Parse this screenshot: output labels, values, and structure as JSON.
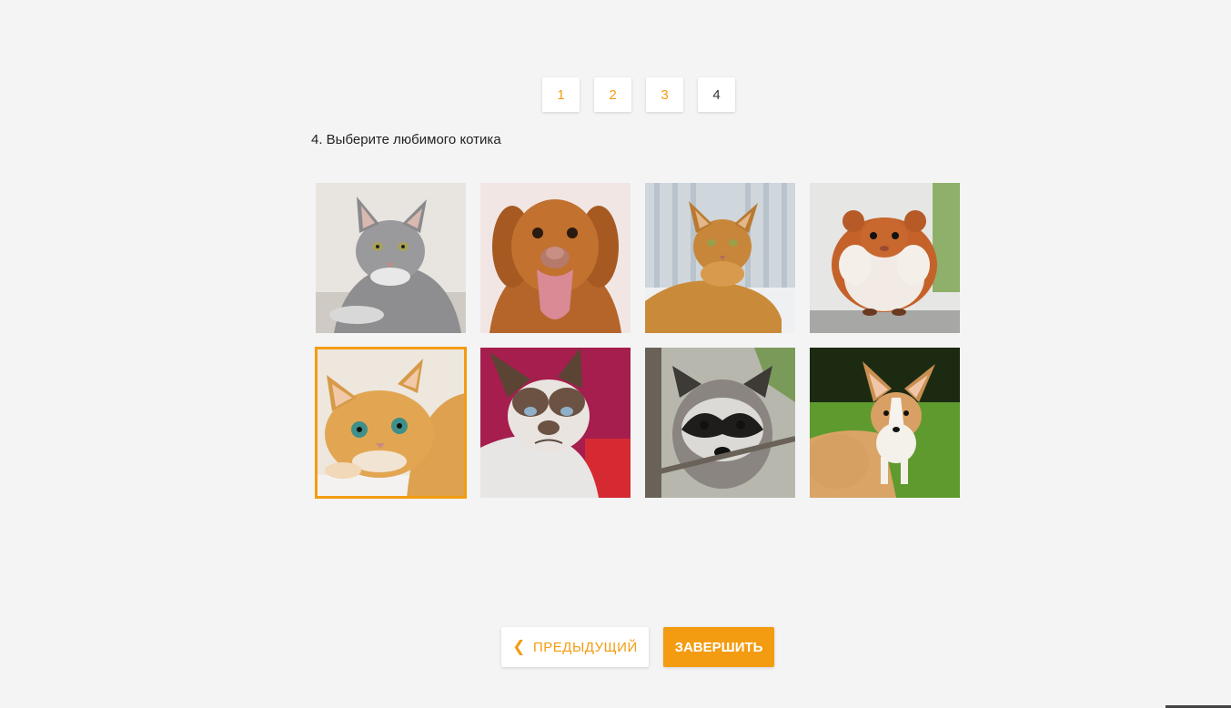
{
  "pager": {
    "pages": [
      "1",
      "2",
      "3",
      "4"
    ],
    "current": "4"
  },
  "question": {
    "text": "4. Выберите любимого котика"
  },
  "images": [
    {
      "name": "grey-tabby-cat",
      "selected": false
    },
    {
      "name": "golden-dog",
      "selected": false
    },
    {
      "name": "ginger-abyssinian-cat",
      "selected": false
    },
    {
      "name": "hamster",
      "selected": false
    },
    {
      "name": "golden-british-cat",
      "selected": true
    },
    {
      "name": "grumpy-cat",
      "selected": false
    },
    {
      "name": "raccoon",
      "selected": false
    },
    {
      "name": "corgi-puppy",
      "selected": false
    }
  ],
  "nav": {
    "prev_label": "ПРЕДЫДУЩИЙ",
    "prev_icon": "chevron-left-icon",
    "finish_label": "ЗАВЕРШИТЬ"
  },
  "colors": {
    "accent": "#f39c12",
    "background": "#f4f4f4"
  }
}
